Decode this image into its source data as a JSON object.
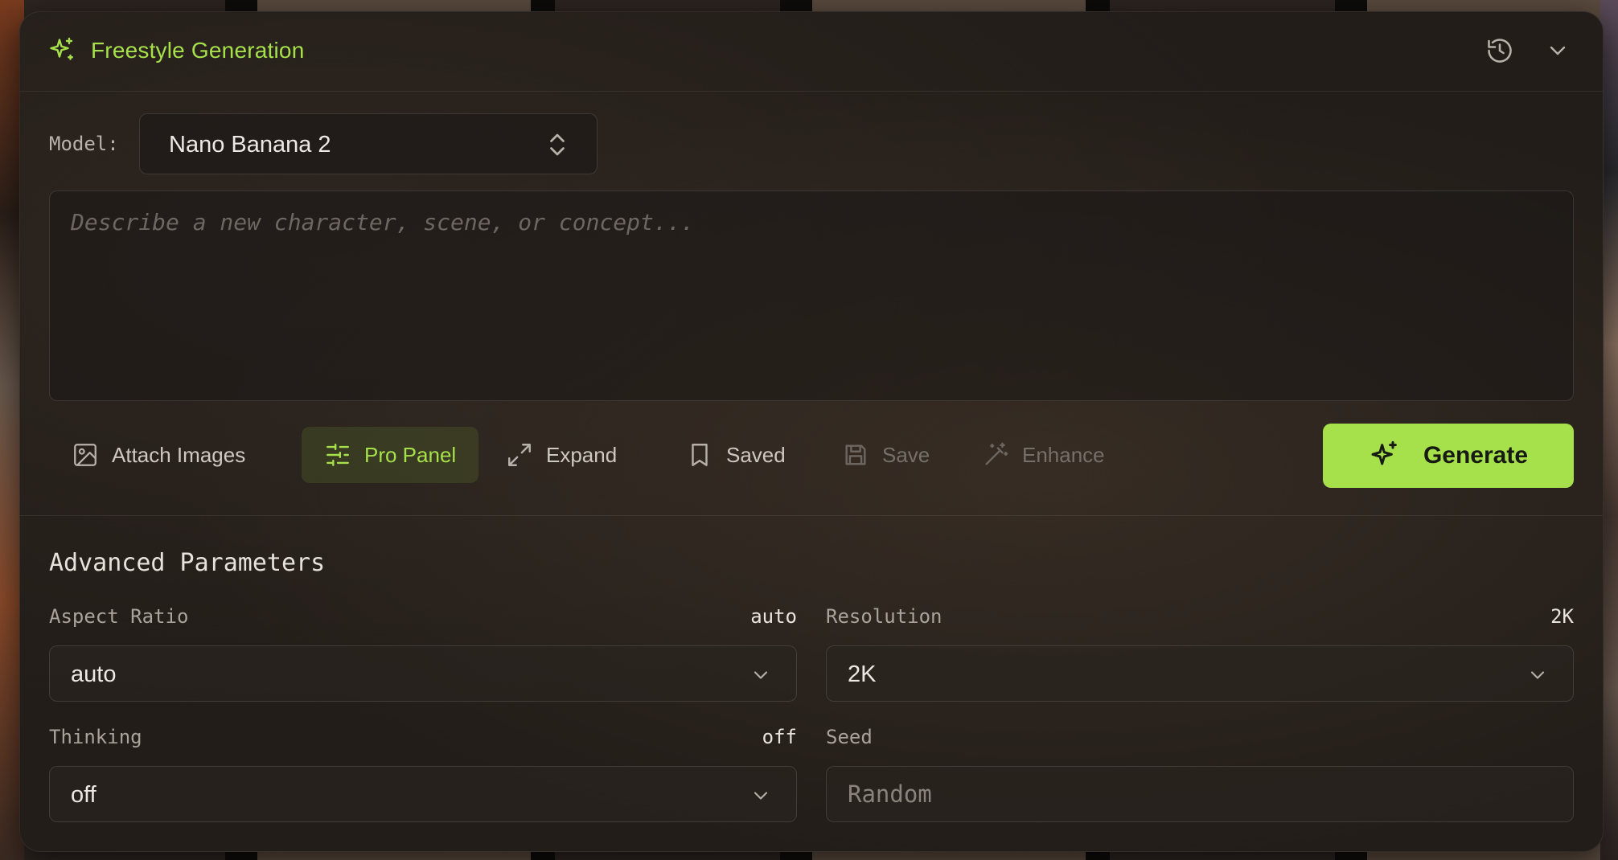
{
  "header": {
    "title": "Freestyle Generation",
    "icons": [
      "sparkle-icon",
      "history-icon",
      "chevron-down-icon"
    ]
  },
  "model": {
    "label": "Model:",
    "selected": "Nano Banana 2"
  },
  "prompt": {
    "placeholder": "Describe a new character, scene, or concept..."
  },
  "toolbar": {
    "attach_label": "Attach Images",
    "pro_panel_label": "Pro Panel",
    "expand_label": "Expand",
    "saved_label": "Saved",
    "save_label": "Save",
    "enhance_label": "Enhance",
    "generate_label": "Generate"
  },
  "advanced": {
    "title": "Advanced Parameters",
    "aspect_ratio": {
      "label": "Aspect Ratio",
      "current": "auto",
      "selected": "auto"
    },
    "resolution": {
      "label": "Resolution",
      "current": "2K",
      "selected": "2K"
    },
    "thinking": {
      "label": "Thinking",
      "current": "off",
      "selected": "off"
    },
    "seed": {
      "label": "Seed",
      "placeholder": "Random"
    }
  },
  "colors": {
    "accent": "#a6e04a",
    "panel_bg": "#221d19",
    "text_muted": "#aaa39c"
  }
}
